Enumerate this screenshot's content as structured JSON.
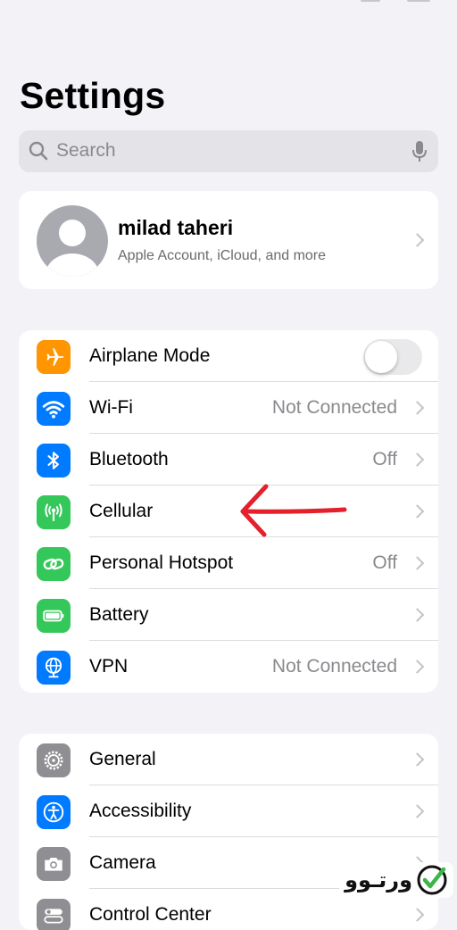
{
  "header": {
    "title": "Settings"
  },
  "search": {
    "placeholder": "Search"
  },
  "profile": {
    "name": "milad taheri",
    "subtitle": "Apple Account, iCloud, and more"
  },
  "connectivity": {
    "items": [
      {
        "label": "Airplane Mode",
        "icon": "airplane-icon",
        "color": "#ff9500",
        "toggle": false
      },
      {
        "label": "Wi-Fi",
        "icon": "wifi-icon",
        "color": "#007aff",
        "value": "Not Connected"
      },
      {
        "label": "Bluetooth",
        "icon": "bluetooth-icon",
        "color": "#007aff",
        "value": "Off"
      },
      {
        "label": "Cellular",
        "icon": "cellular-antenna-icon",
        "color": "#34c759",
        "value": ""
      },
      {
        "label": "Personal Hotspot",
        "icon": "hotspot-link-icon",
        "color": "#34c759",
        "value": "Off"
      },
      {
        "label": "Battery",
        "icon": "battery-icon",
        "color": "#34c759",
        "value": ""
      },
      {
        "label": "VPN",
        "icon": "vpn-globe-icon",
        "color": "#007aff",
        "value": "Not Connected"
      }
    ]
  },
  "system": {
    "items": [
      {
        "label": "General",
        "icon": "gear-icon",
        "color": "#8e8e93"
      },
      {
        "label": "Accessibility",
        "icon": "accessibility-icon",
        "color": "#007aff"
      },
      {
        "label": "Camera",
        "icon": "camera-icon",
        "color": "#8e8e93"
      },
      {
        "label": "Control Center",
        "icon": "control-center-icon",
        "color": "#8e8e93"
      }
    ]
  },
  "annotation": {
    "color": "#e3202c",
    "target": "Cellular"
  },
  "watermark": {
    "text": "ورتـوو",
    "check_color": "#3cb54a"
  }
}
